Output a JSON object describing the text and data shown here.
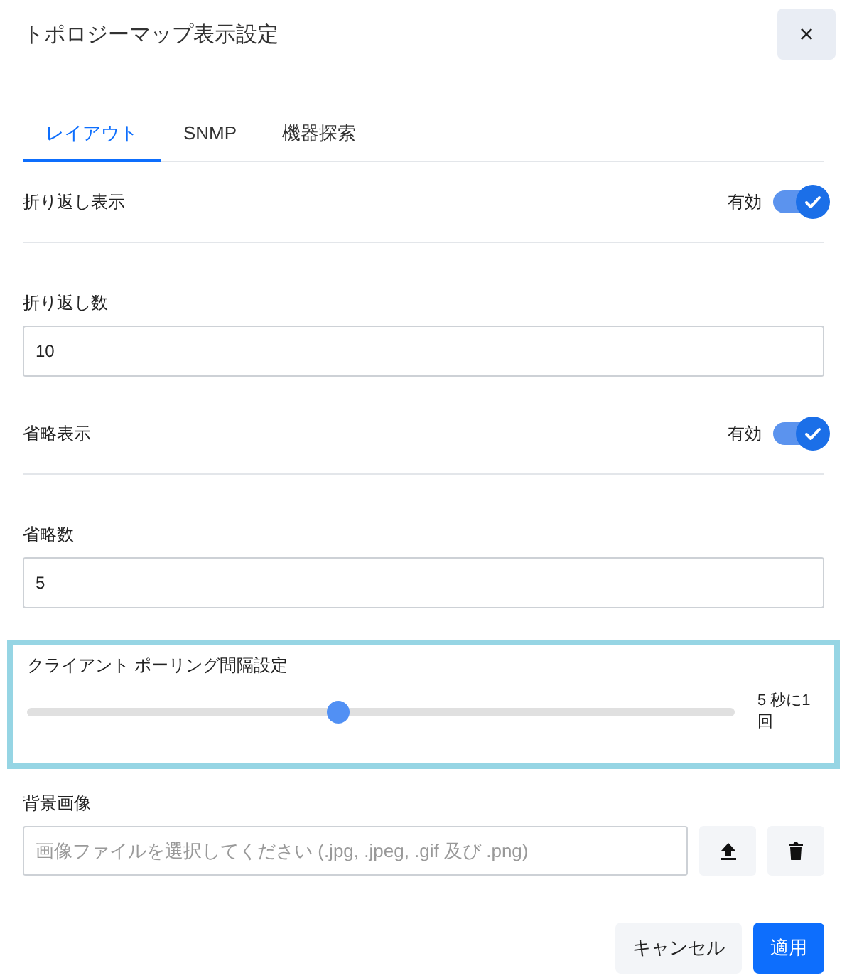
{
  "dialog": {
    "title": "トポロジーマップ表示設定",
    "close": "×"
  },
  "tabs": [
    {
      "label": "レイアウト",
      "selected": true
    },
    {
      "label": "SNMP",
      "selected": false
    },
    {
      "label": "機器探索",
      "selected": false
    }
  ],
  "settings": [
    {
      "kind": "toggle",
      "label": "折り返し表示",
      "state_label": "有効",
      "on": true
    },
    {
      "kind": "number",
      "label": "折り返し数",
      "value": "10"
    },
    {
      "kind": "toggle",
      "label": "省略表示",
      "state_label": "有効",
      "on": true
    },
    {
      "kind": "number",
      "label": "省略数",
      "value": "5"
    },
    {
      "kind": "slider",
      "label": "クライアント ポーリング間隔設定",
      "level": 0.44,
      "reading": "5 秒に1回",
      "focused": true
    },
    {
      "kind": "file",
      "label": "背景画像",
      "placeholder": "画像ファイルを選択してください (.jpg, .jpeg, .gif 及び .png)"
    }
  ],
  "buttons": [
    {
      "label": "キャンセル",
      "primary": false
    },
    {
      "label": "適用",
      "primary": true
    }
  ]
}
